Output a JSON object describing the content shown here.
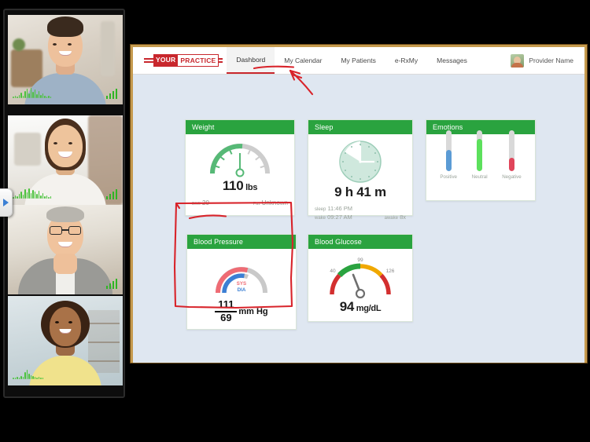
{
  "app": {
    "frame_border_color": "#c59a4e",
    "canvas_bg": "#dfe7f1",
    "accent_green": "#2aa33f",
    "brand_red": "#c8272d"
  },
  "topbar": {
    "logo": {
      "part1": "YOUR",
      "part2": "PRACTICE"
    },
    "nav": [
      {
        "label": "Dashbord",
        "active": true
      },
      {
        "label": "My Calendar",
        "active": false
      },
      {
        "label": "My Patients",
        "active": false
      },
      {
        "label": "e-RxMy",
        "active": false
      },
      {
        "label": "Messages",
        "active": false
      }
    ],
    "provider": {
      "name": "Provider Name",
      "avatar_icon": "user-avatar-icon"
    }
  },
  "cards": {
    "weight": {
      "title": "Weight",
      "value": "110",
      "unit": "lbs",
      "bmi_label": "BMI",
      "bmi_value": "20",
      "fat_label": "Fat",
      "fat_value": "Unknown",
      "gauge_icon": "speedometer-gauge-icon"
    },
    "sleep": {
      "title": "Sleep",
      "value": "9 h 41 m",
      "sleep_label": "sleep",
      "sleep_time": "11:46 PM",
      "wake_label": "wake",
      "wake_time": "09:27 AM",
      "awake_label": "awake",
      "awake_count": "8x",
      "clock_icon": "clock-face-icon"
    },
    "emotions": {
      "title": "Emotions",
      "bars": [
        {
          "label": "Positive",
          "pct": 52,
          "color": "#5b9bd5"
        },
        {
          "label": "Neutral",
          "pct": 78,
          "color": "#5ce05c"
        },
        {
          "label": "Negative",
          "pct": 33,
          "color": "#e0455a"
        }
      ]
    },
    "blood_pressure": {
      "title": "Blood Pressure",
      "systolic": "111",
      "diastolic": "69",
      "unit": "mm Hg",
      "sys_label": "SYS",
      "dia_label": "DIA",
      "sys_color": "#ef6b74",
      "dia_color": "#3b7fd4",
      "gauge_icon": "dual-arc-gauge-icon"
    },
    "blood_glucose": {
      "title": "Blood Glucose",
      "value": "94",
      "unit": "mg/dL",
      "ticks": [
        "40",
        "99",
        "126"
      ],
      "gauge_icon": "needle-gauge-icon"
    }
  },
  "annotations": {
    "arrow_target": "My Calendar",
    "underline_target": "Blood Pressure",
    "box_target": "Blood Pressure card",
    "ink_color": "#d8232a"
  },
  "video_rail": {
    "drawer_icon": "expand-right-triangle-icon",
    "tiles": [
      {
        "name": "participant-1",
        "waveform": true,
        "signal": true,
        "signal_bars": 4
      },
      {
        "name": "participant-2",
        "waveform": true,
        "signal": true,
        "signal_bars": 4
      },
      {
        "name": "participant-3",
        "waveform": false,
        "signal": true,
        "signal_bars": 4
      },
      {
        "name": "participant-4",
        "waveform": true,
        "signal": false,
        "signal_bars": 0
      }
    ]
  }
}
